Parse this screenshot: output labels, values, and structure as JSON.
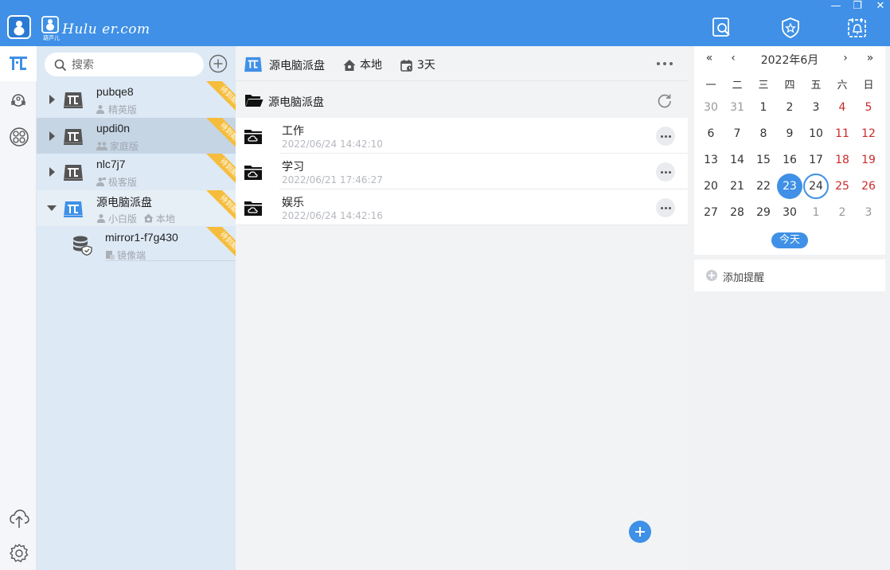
{
  "app": {
    "brand_text": "Hulu er.com",
    "brand_sub": "葫芦儿",
    "accent": "#3f90e6"
  },
  "window_controls": {
    "minimize": "—",
    "restore": "❐",
    "close": "✕"
  },
  "top_icons": [
    "search-doc-icon",
    "shield-star-icon",
    "calendar-bell-icon"
  ],
  "rail": {
    "items": [
      "pi-logo-icon",
      "headset-icon",
      "apps-icon"
    ],
    "bottom": [
      "cloud-upload-icon",
      "gear-icon"
    ]
  },
  "devices": {
    "search_placeholder": "搜索",
    "ribbon": "待到期",
    "list": [
      {
        "name": "pubqe8",
        "sub": "精英版",
        "state": "collapsed"
      },
      {
        "name": "updi0n",
        "sub": "家庭版",
        "state": "selected"
      },
      {
        "name": "nlc7j7",
        "sub": "极客版",
        "state": "collapsed"
      },
      {
        "name": "源电脑派盘",
        "sub": "小白版",
        "sub2": "本地",
        "state": "open"
      }
    ],
    "mirror": {
      "name": "mirror1-f7g430",
      "sub": "镜像端"
    }
  },
  "files": {
    "breadcrumb": {
      "drive": "源电脑派盘",
      "location": "本地",
      "days": "3天"
    },
    "folder_title": "源电脑派盘",
    "items": [
      {
        "name": "工作",
        "time": "2022/06/24 14:42:10"
      },
      {
        "name": "学习",
        "time": "2022/06/21 17:46:27"
      },
      {
        "name": "娱乐",
        "time": "2022/06/24 14:42:16"
      }
    ]
  },
  "calendar": {
    "title": "2022年6月",
    "nav": {
      "prev_year": "«",
      "prev_month": "‹",
      "next_month": "›",
      "next_year": "»"
    },
    "weekdays": [
      "一",
      "二",
      "三",
      "四",
      "五",
      "六",
      "日"
    ],
    "weeks": [
      [
        "30",
        "31",
        "1",
        "2",
        "3",
        "4",
        "5"
      ],
      [
        "6",
        "7",
        "8",
        "9",
        "10",
        "11",
        "12"
      ],
      [
        "13",
        "14",
        "15",
        "16",
        "17",
        "18",
        "19"
      ],
      [
        "20",
        "21",
        "22",
        "23",
        "24",
        "25",
        "26"
      ],
      [
        "27",
        "28",
        "29",
        "30",
        "1",
        "2",
        "3"
      ]
    ],
    "muted": [
      [
        0,
        0
      ],
      [
        0,
        1
      ],
      [
        4,
        4
      ],
      [
        4,
        5
      ],
      [
        4,
        6
      ]
    ],
    "selected": [
      3,
      3
    ],
    "today": [
      3,
      4
    ],
    "today_label": "今天",
    "add_reminder": "添加提醒"
  }
}
